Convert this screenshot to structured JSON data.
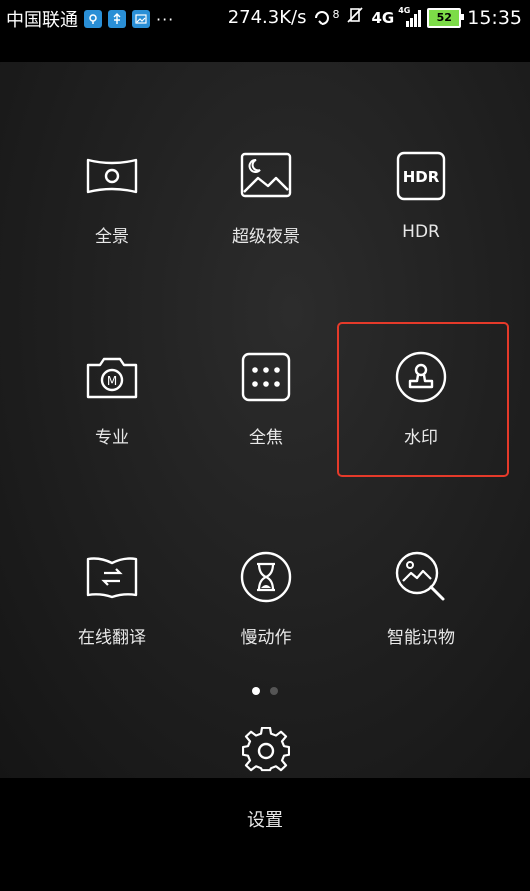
{
  "status_bar": {
    "carrier": "中国联通",
    "more": "···",
    "speed": "274.3K/s",
    "signal_badge": "8",
    "network": "4G",
    "network2": "4G",
    "battery": "52",
    "time": "15:35"
  },
  "modes": [
    {
      "label": "全景",
      "icon": "panorama-icon"
    },
    {
      "label": "超级夜景",
      "icon": "night-scene-icon"
    },
    {
      "label": "HDR",
      "icon": "hdr-icon",
      "icon_text": "HDR"
    },
    {
      "label": "专业",
      "icon": "pro-camera-icon",
      "icon_text": "M"
    },
    {
      "label": "全焦",
      "icon": "all-focus-icon"
    },
    {
      "label": "水印",
      "icon": "watermark-stamp-icon"
    },
    {
      "label": "在线翻译",
      "icon": "translate-book-icon"
    },
    {
      "label": "慢动作",
      "icon": "slow-motion-hourglass-icon"
    },
    {
      "label": "智能识物",
      "icon": "object-recognition-icon"
    }
  ],
  "pager": {
    "current": 1,
    "total": 2
  },
  "settings": {
    "label": "设置"
  },
  "colors": {
    "highlight": "#e53a2a",
    "accent_status": "#2a8fd6",
    "battery": "#7ddc48"
  }
}
